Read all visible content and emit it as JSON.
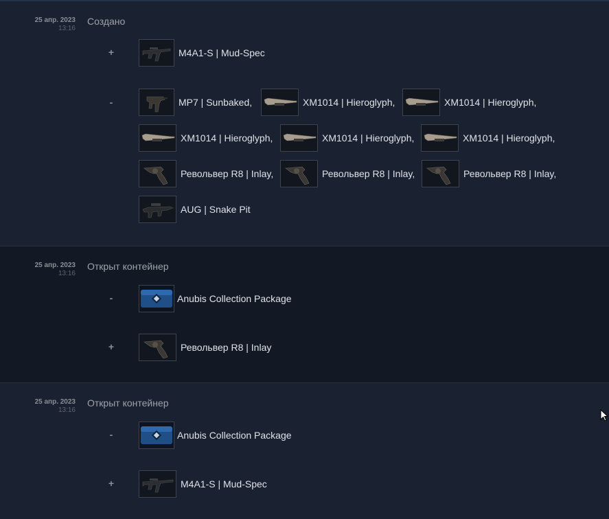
{
  "entries": [
    {
      "date": "25 апр. 2023",
      "time": "13:16",
      "title": "Создано",
      "groups": [
        {
          "sign": "+",
          "items": [
            {
              "label": "M4A1-S | Mud-Spec",
              "icon": "rifle-m4a1s-icon"
            }
          ]
        },
        {
          "sign": "-",
          "items": [
            {
              "label": "MP7 | Sunbaked,",
              "icon": "smg-mp7-icon"
            },
            {
              "label": "XM1014 | Hieroglyph,",
              "icon": "shotgun-xm1014-icon"
            },
            {
              "label": "XM1014 | Hieroglyph,",
              "icon": "shotgun-xm1014-icon"
            },
            {
              "label": "XM1014 | Hieroglyph,",
              "icon": "shotgun-xm1014-icon"
            },
            {
              "label": "XM1014 | Hieroglyph,",
              "icon": "shotgun-xm1014-icon"
            },
            {
              "label": "XM1014 | Hieroglyph,",
              "icon": "shotgun-xm1014-icon"
            },
            {
              "label": "Револьвер R8 | Inlay,",
              "icon": "revolver-r8-icon"
            },
            {
              "label": "Револьвер R8 | Inlay,",
              "icon": "revolver-r8-icon"
            },
            {
              "label": "Револьвер R8 | Inlay,",
              "icon": "revolver-r8-icon"
            },
            {
              "label": "AUG | Snake Pit",
              "icon": "rifle-aug-icon"
            }
          ]
        }
      ]
    },
    {
      "date": "25 апр. 2023",
      "time": "13:16",
      "title": "Открыт контейнер",
      "groups": [
        {
          "sign": "-",
          "items": [
            {
              "label": "Anubis Collection Package",
              "icon": "package-case-icon"
            }
          ]
        },
        {
          "sign": "+",
          "items": [
            {
              "label": "Револьвер R8 | Inlay",
              "icon": "revolver-r8-icon"
            }
          ]
        }
      ]
    },
    {
      "date": "25 апр. 2023",
      "time": "13:16",
      "title": "Открыт контейнер",
      "groups": [
        {
          "sign": "-",
          "items": [
            {
              "label": "Anubis Collection Package",
              "icon": "package-case-icon"
            }
          ]
        },
        {
          "sign": "+",
          "items": [
            {
              "label": "M4A1-S | Mud-Spec",
              "icon": "rifle-m4a1s-icon"
            }
          ]
        }
      ]
    }
  ],
  "colors": {
    "background": "#1b2230",
    "row_alt": "#131924",
    "text": "#dfe3e8",
    "muted": "#9ea3ab",
    "thumb_border": "#3d4450"
  }
}
